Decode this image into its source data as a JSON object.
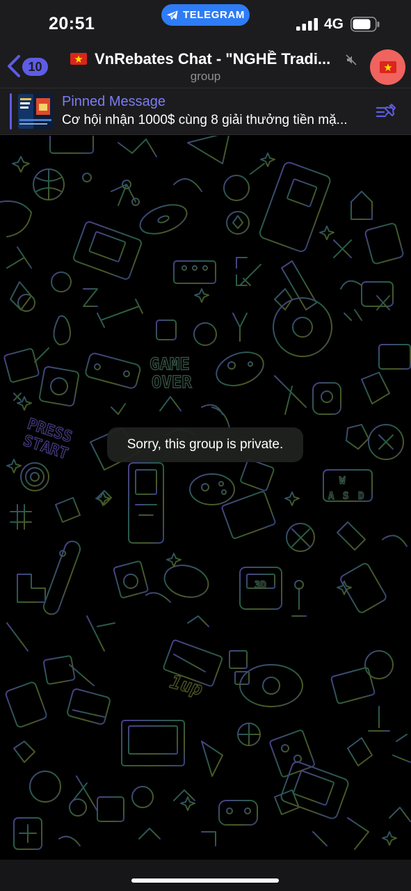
{
  "status": {
    "time": "20:51",
    "app_pill": "TELEGRAM",
    "network": "4G",
    "icons": [
      "telegram-plane-icon",
      "signal-bars-icon",
      "battery-icon"
    ]
  },
  "header": {
    "back_badge": "10",
    "title": "VnRebates Chat - \"NGHỀ Tradi...",
    "subtitle": "group",
    "icons": [
      "chevron-left-icon",
      "vietnam-flag-icon",
      "muted-icon"
    ]
  },
  "pinned": {
    "label": "Pinned Message",
    "text": "Cơ hội nhận 1000$ cùng 8 giải thưởng tiền mặ...",
    "icons": [
      "pinned-list-icon"
    ]
  },
  "chat": {
    "service_message": "Sorry, this group is private.",
    "wallpaper_text": [
      "GAME",
      "OVER",
      "PRESS",
      "START",
      "1up",
      "3D",
      "W",
      "A",
      "S",
      "D"
    ]
  },
  "colors": {
    "accent": "#5e5ce6",
    "pill": "#2e7cf6",
    "avatar": "#f0635f",
    "bar_bg": "#1c1c1e",
    "subtitle": "#8e8e93"
  }
}
